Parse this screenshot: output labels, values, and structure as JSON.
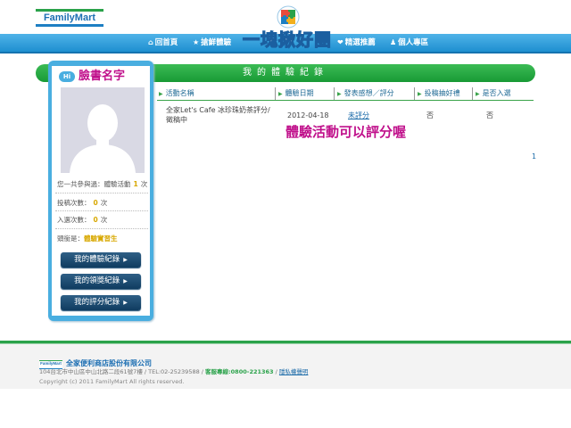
{
  "header": {
    "logo_text": "FamilyMart",
    "brand_title": "一塊揪好團",
    "nav": [
      {
        "label": "回首頁",
        "icon": "home-icon"
      },
      {
        "label": "搶鮮體驗",
        "icon": "star-icon"
      },
      {
        "label": "精選推薦",
        "icon": "heart-icon"
      },
      {
        "label": "個人專區",
        "icon": "user-icon"
      }
    ]
  },
  "page_title": "我的體驗紀錄",
  "profile": {
    "hi_label": "Hi",
    "name": "臉書名字",
    "participation_prefix": "您一共參與過：體驗活動",
    "participation_count": "1",
    "participation_unit": "次",
    "submissions_prefix": "投稿次數：",
    "submissions_count": "0",
    "submissions_unit": "次",
    "selected_prefix": "入選次數：",
    "selected_count": "0",
    "selected_unit": "次",
    "rank_prefix": "頭銜是：",
    "rank_value": "體驗實習生",
    "menu": [
      {
        "label": "我的體驗紀錄"
      },
      {
        "label": "我的領獎紀錄"
      },
      {
        "label": "我的評分紀錄"
      }
    ]
  },
  "table": {
    "columns": [
      "活動名稱",
      "體驗日期",
      "發表感想／評分",
      "投稿抽好禮",
      "是否入選"
    ],
    "rows": [
      {
        "activity": "全家Let's Cafe 冰珍珠奶茶評分/徵稿中",
        "date": "2012-04-18",
        "review": "未評分",
        "share": "否",
        "winner": "否"
      }
    ],
    "note": "體驗活動可以評分喔",
    "page": "1"
  },
  "footer": {
    "logo_text": "FamilyMart",
    "company": "全家便利商店股份有限公司",
    "address": "104台北市中山區中山北路二段61號7樓 / TEL:02-25239588 / ",
    "service_label": "客服專線:",
    "service_phone": "0800-221363",
    "separator": " / ",
    "privacy": "隱私權聲明",
    "copyright": "Copyright (c) 2011 FamilyMart  All rights reserved."
  },
  "colors": {
    "green": "#2aa24a",
    "blue": "#1d7fc3",
    "panel_blue": "#49aee0",
    "magenta": "#c0108b",
    "gold": "#d8a800",
    "dark_button": "#0f3c60"
  }
}
